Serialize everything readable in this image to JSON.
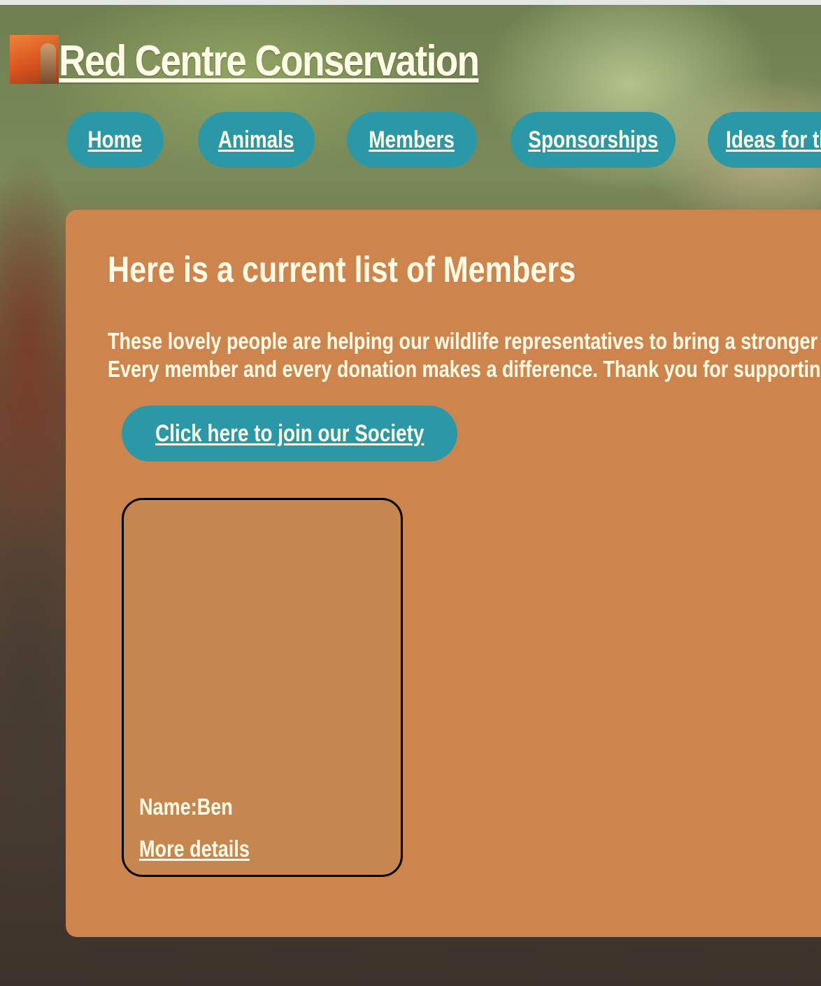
{
  "site": {
    "title": "Red Centre Conservation"
  },
  "nav": {
    "items": [
      {
        "label": "Home"
      },
      {
        "label": "Animals"
      },
      {
        "label": "Members"
      },
      {
        "label": "Sponsorships"
      },
      {
        "label": "Ideas for th"
      }
    ]
  },
  "main": {
    "heading": "Here is a current list of Members",
    "intro_line1": "These lovely people are helping our wildlife representatives to bring a stronger me",
    "intro_line2": "Every member and every donation makes a difference. Thank you for supporting o",
    "join_label": "Click here to join our Society"
  },
  "members": [
    {
      "name": "Name:Ben",
      "link_label": "More details"
    }
  ],
  "colors": {
    "accent": "#2a98a6",
    "panel": "#cd854d",
    "card": "#c6864f",
    "text": "#fffbe6"
  }
}
